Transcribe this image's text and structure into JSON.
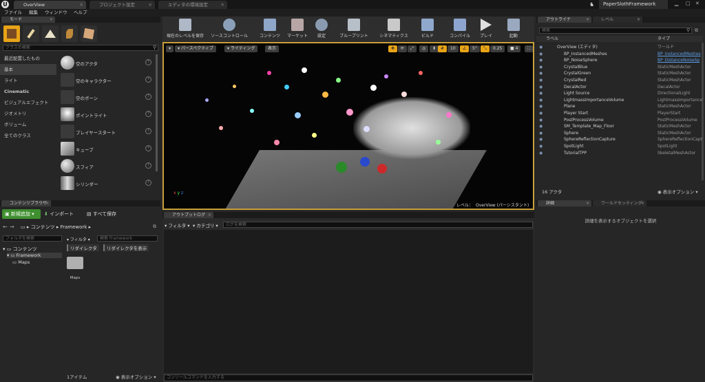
{
  "title_tabs": [
    {
      "label": "OverView",
      "active": true
    },
    {
      "label": "プロジェクト設定",
      "active": false
    },
    {
      "label": "エディタの環境設定",
      "active": false
    }
  ],
  "project_name": "PaperSlothFramework",
  "menu": [
    "ファイル",
    "編集",
    "ウィンドウ",
    "ヘルプ"
  ],
  "modes": {
    "tab": "モード",
    "search_placeholder": "クラスの検索",
    "categories": [
      "最近配置したもの",
      "基本",
      "ライト",
      "Cinematic",
      "ビジュアルエフェクト",
      "ジオメトリ",
      "ボリューム",
      "全てのクラス"
    ],
    "selected_category": "基本",
    "items": [
      "空のアクタ",
      "空のキャラクター",
      "空のポーン",
      "ポイントライト",
      "プレイヤースタート",
      "キューブ",
      "スフィア",
      "シリンダー"
    ]
  },
  "toolbar": [
    "現在のレベルを保存",
    "ソースコントロール",
    "コンテンツ",
    "マーケット",
    "設定",
    "ブループリント",
    "シネマティクス",
    "ビルド",
    "コンパイル",
    "プレイ",
    "起動"
  ],
  "viewport": {
    "perspective": "パースペクティブ",
    "lighting": "ライティング",
    "show": "表示",
    "grid": "10",
    "angle": "5°",
    "scale": "0.25",
    "camera": "4",
    "level_label": "レベル：",
    "level_name": "OverView (パーシスタント)"
  },
  "content_browser": {
    "tab": "コンテンツブラウザ",
    "add_new": "新規追加",
    "import": "インポート",
    "save_all": "すべて保存",
    "path_root": "コンテンツ",
    "path_sub": "Framework",
    "folder_search_placeholder": "フォルダを検索",
    "filter": "フィルタ",
    "search_placeholder": "検索 Framework",
    "tree": [
      "コンテンツ",
      "Framework",
      "Maps"
    ],
    "redirect_btn": "リダイレクタ",
    "show_redirect_btn": "リダイレクタを表示",
    "asset_name": "Maps",
    "item_count": "1アイテム",
    "view_options": "表示オプション"
  },
  "output_log": {
    "tab": "アウトプットログ",
    "filter": "フィルタ",
    "category": "カテゴリ",
    "search_placeholder": "ログを検索",
    "console_placeholder": "コンソールコマンドを入力する"
  },
  "outliner": {
    "tab": "アウトライナ",
    "tab2": "レベル",
    "search_placeholder": "検索",
    "col_label": "ラベル",
    "col_type": "タイプ",
    "rows": [
      {
        "name": "OverView (エディタ)",
        "type": "ワールド",
        "indent": 0,
        "link": false
      },
      {
        "name": "BP_InstancedMeshes",
        "type": "BP_InstancedMeshes",
        "indent": 1,
        "link": true
      },
      {
        "name": "BP_NoiseSphere",
        "type": "BP_DistanceNoiseSp",
        "indent": 1,
        "link": true
      },
      {
        "name": "CrystalBlue",
        "type": "StaticMeshActor",
        "indent": 1,
        "link": false
      },
      {
        "name": "CrystalGreen",
        "type": "StaticMeshActor",
        "indent": 1,
        "link": false
      },
      {
        "name": "CrystalRed",
        "type": "StaticMeshActor",
        "indent": 1,
        "link": false
      },
      {
        "name": "DecalActor",
        "type": "DecalActor",
        "indent": 1,
        "link": false
      },
      {
        "name": "Light Source",
        "type": "DirectionalLight",
        "indent": 1,
        "link": false
      },
      {
        "name": "LightmassImportanceVolume",
        "type": "LightmassImportanceV",
        "indent": 1,
        "link": false
      },
      {
        "name": "Plane",
        "type": "StaticMeshActor",
        "indent": 1,
        "link": false
      },
      {
        "name": "Player Start",
        "type": "PlayerStart",
        "indent": 1,
        "link": false
      },
      {
        "name": "PostProcessVolume",
        "type": "PostProcessVolume",
        "indent": 1,
        "link": false
      },
      {
        "name": "SM_Template_Map_Floor",
        "type": "StaticMeshActor",
        "indent": 1,
        "link": false
      },
      {
        "name": "Sphere",
        "type": "StaticMeshActor",
        "indent": 1,
        "link": false
      },
      {
        "name": "SphereReflectionCapture",
        "type": "SphereReflectionCapt",
        "indent": 1,
        "link": false
      },
      {
        "name": "SpotLight",
        "type": "SpotLight",
        "indent": 1,
        "link": false
      },
      {
        "name": "TutorialTPP",
        "type": "SkeletalMeshActor",
        "indent": 1,
        "link": false
      }
    ],
    "actor_count": "16 アクタ",
    "view_options": "表示オプション"
  },
  "details": {
    "tab": "詳細",
    "tab2": "ワールドセッティング",
    "empty_msg": "詳細を表示するオブジェクトを選択"
  },
  "colors": {
    "accent": "#e8a317",
    "add_green": "#3f8f2f",
    "link": "#5e9fe8"
  }
}
